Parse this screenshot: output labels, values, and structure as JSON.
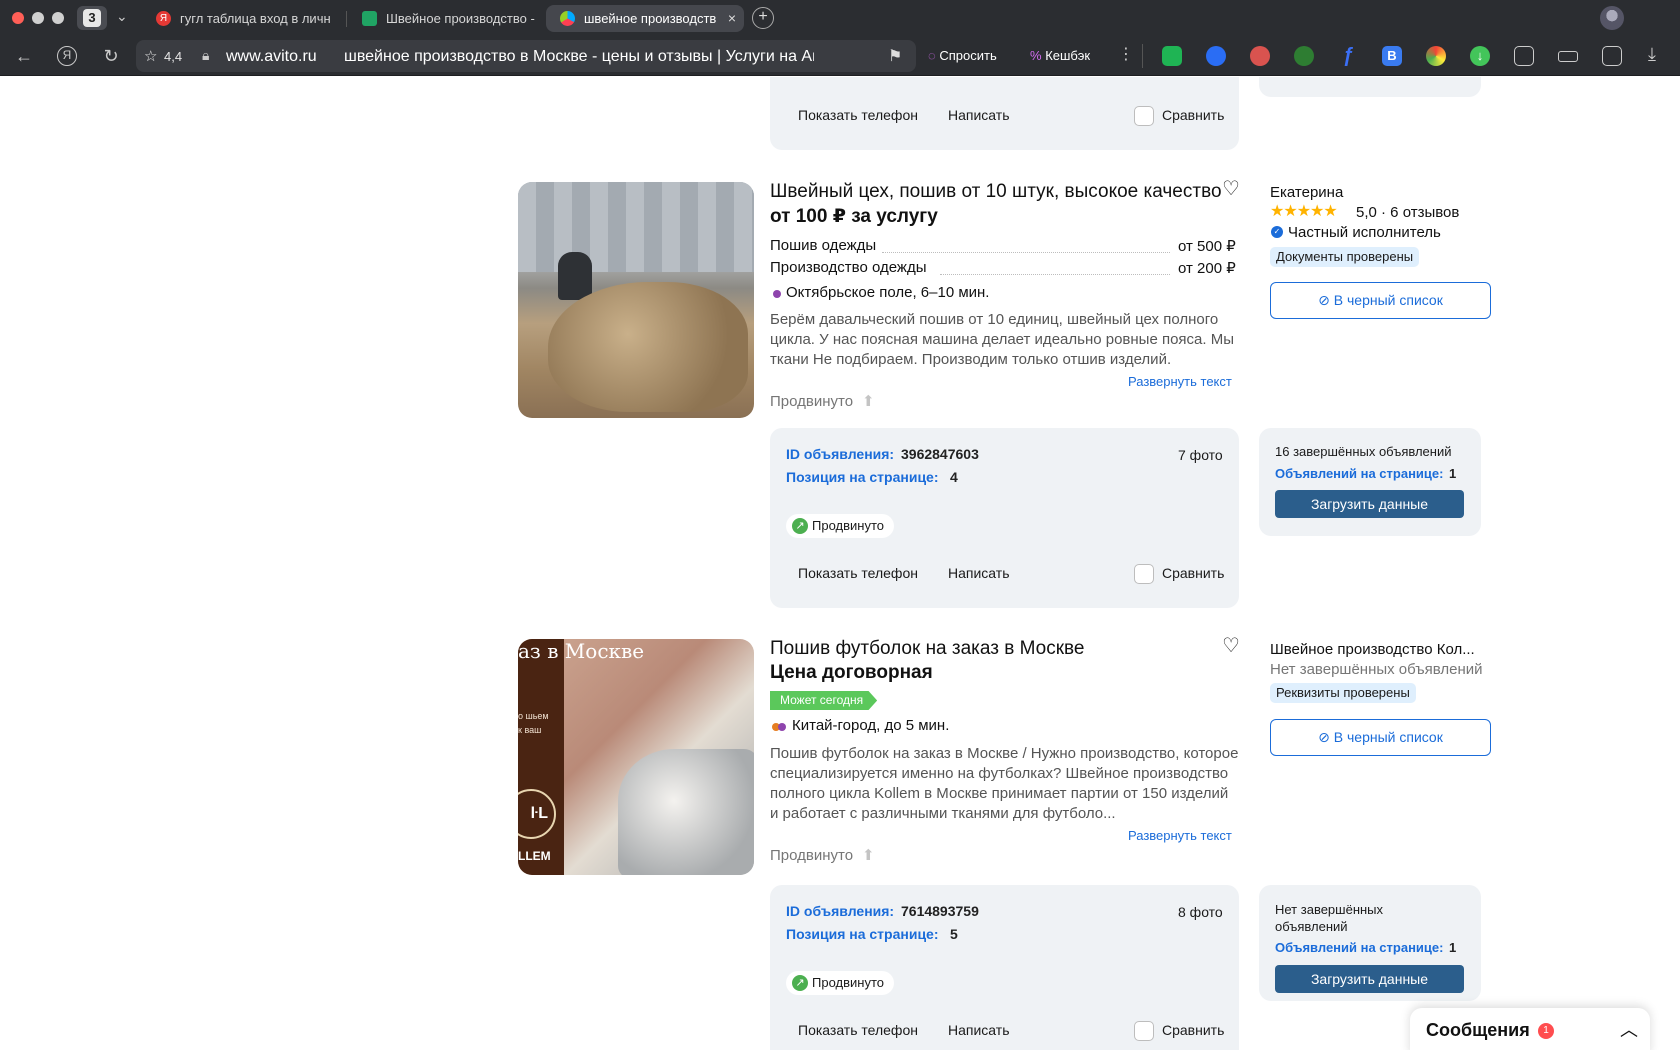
{
  "browser": {
    "tab_count": "3",
    "tabs": [
      {
        "label": "гугл таблица вход в личн"
      },
      {
        "label": "Швейное производство -"
      },
      {
        "label": "швейное производств"
      }
    ],
    "rating": "4,4",
    "url_host": "www.avito.ru",
    "url_title": "швейное производство в Москве - цены и отзывы | Услуги на Ави...",
    "ask_label": "Спросить",
    "cashback_label": "Кешбэк"
  },
  "top_card": {
    "show_phone": "Показать телефон",
    "write": "Написать",
    "compare": "Сравнить"
  },
  "listings": [
    {
      "title": "Швейный цех, пошив от 10 штук, высокое качество",
      "price": "от 100 ₽ за услугу",
      "services": [
        {
          "name": "Пошив одежды",
          "price": "от 500 ₽"
        },
        {
          "name": "Производство одежды",
          "price": "от 200 ₽"
        }
      ],
      "metro": "Октябрьское поле, 6–10 мин.",
      "description": "Берём давальческий пошив от 10 единиц, швейный цех полного цикла. У нас поясная машина делает идеально ровные пояса. Мы ткани Не подбираем. Производим только отшив изделий.",
      "expand": "Развернуть текст",
      "promoted": "Продвинуто",
      "seller": {
        "name": "Екатерина",
        "rating": "5,0 · 6 отзывов",
        "type": "Частный исполнитель",
        "badge": "Документы проверены",
        "blacklist": "В черный список"
      },
      "meta": {
        "id_label": "ID объявления:",
        "id_value": "3962847603",
        "position_label": "Позиция на странице:",
        "position_value": "4",
        "photos": "7 фото",
        "promo_tag": "Продвинуто",
        "show_phone": "Показать телефон",
        "write": "Написать",
        "compare": "Сравнить"
      },
      "side": {
        "completed": "16 завершённых объявлений",
        "on_page_label": "Объявлений на странице:",
        "on_page_value": "1",
        "load": "Загрузить данные"
      }
    },
    {
      "title": "Пошив футболок на заказ в Москве",
      "price": "Цена договорная",
      "today_badge": "Может сегодня",
      "metro": "Китай-город, до 5 мин.",
      "description": "Пошив футболок на заказ в Москве / Нужно производство, которое специализируется именно на футболках? Швейное производство полного цикла Kollem в Москве принимает партии от 150 изделий и работает с различными тканями для футболо...",
      "expand": "Развернуть текст",
      "promoted": "Продвинуто",
      "photo_text": {
        "top": "аз в Москве",
        "mid1": "о шьем",
        "mid2": "к ваш",
        "logo": "ŀL",
        "brand": "LLEM"
      },
      "seller": {
        "name": "Швейное производство Кол...",
        "sub": "Нет завершённых объявлений",
        "badge": "Реквизиты проверены",
        "blacklist": "В черный список"
      },
      "meta": {
        "id_label": "ID объявления:",
        "id_value": "7614893759",
        "position_label": "Позиция на странице:",
        "position_value": "5",
        "photos": "8 фото",
        "promo_tag": "Продвинуто",
        "show_phone": "Показать телефон",
        "write": "Написать",
        "compare": "Сравнить"
      },
      "side": {
        "completed": "Нет завершённых объявлений",
        "on_page_label": "Объявлений на странице:",
        "on_page_value": "1",
        "load": "Загрузить данные"
      }
    }
  ],
  "messages": {
    "label": "Сообщения",
    "count": "1"
  },
  "colors": {
    "accent": "#1b6cd9",
    "button": "#2b5e8c",
    "panel": "#eff2f5",
    "green": "#4caf50"
  }
}
